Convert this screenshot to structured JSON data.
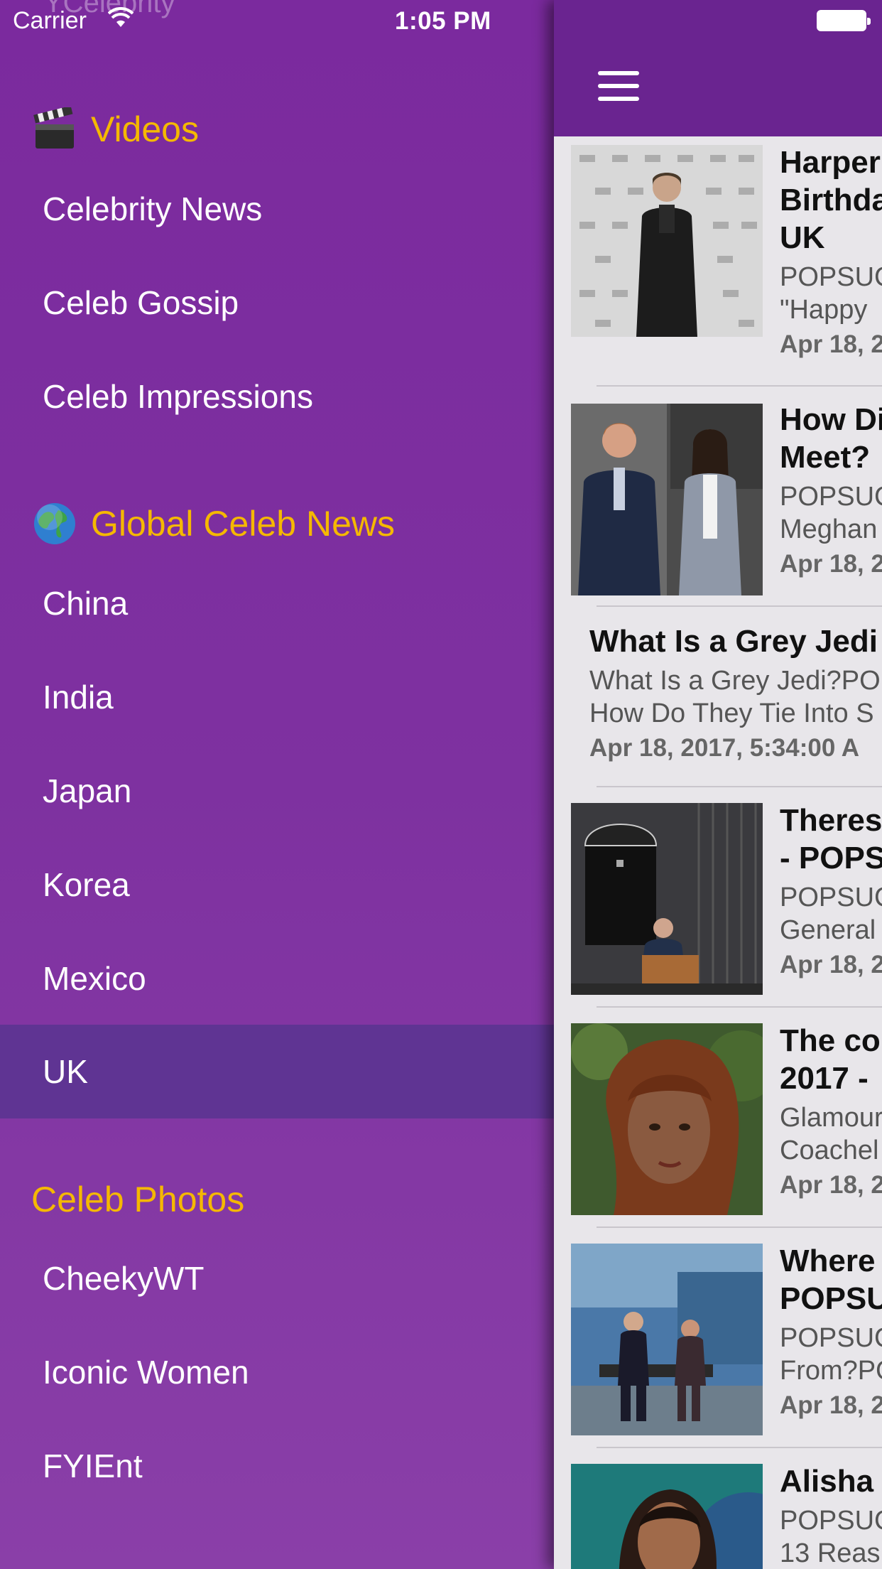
{
  "status_bar": {
    "carrier": "Carrier",
    "time": "1:05 PM"
  },
  "drawer": {
    "ghost_title": "YCelebrity",
    "sections": [
      {
        "header": "Videos",
        "icon": "clapperboard-icon",
        "items": [
          "Celebrity News",
          "Celeb Gossip",
          "Celeb Impressions"
        ]
      },
      {
        "header": "Global Celeb News",
        "icon": "globe-icon",
        "items": [
          "China",
          "India",
          "Japan",
          "Korea",
          "Mexico",
          "UK"
        ]
      },
      {
        "header": "Celeb Photos",
        "icon": "",
        "items": [
          "CheekyWT",
          "Iconic Women",
          "FYIEnt"
        ]
      }
    ],
    "selected_item": "UK"
  },
  "feed": {
    "cards": [
      {
        "title_lines": [
          "Harper",
          "Birthda",
          "UK"
        ],
        "desc_lines": [
          "POPSUC",
          "\"Happy"
        ],
        "date": "Apr 18, 2",
        "has_image": true
      },
      {
        "title_lines": [
          "How Di",
          "Meet?"
        ],
        "desc_lines": [
          "POPSUC",
          "Meghan"
        ],
        "date": "Apr 18, 2",
        "has_image": true
      },
      {
        "title_lines": [
          "What Is a Grey Jedi"
        ],
        "desc_lines": [
          "What Is a Grey Jedi?PO",
          "How Do They Tie Into S"
        ],
        "date": "Apr 18, 2017, 5:34:00 A",
        "has_image": false
      },
      {
        "title_lines": [
          "Theres",
          "- POPS"
        ],
        "desc_lines": [
          "POPSUC",
          "General"
        ],
        "date": "Apr 18, 2",
        "has_image": true
      },
      {
        "title_lines": [
          "The co",
          "2017 -"
        ],
        "desc_lines": [
          "Glamour",
          "Coachel"
        ],
        "date": "Apr 18, 2",
        "has_image": true
      },
      {
        "title_lines": [
          "Where",
          "POPSU"
        ],
        "desc_lines": [
          "POPSUC",
          "From?PO"
        ],
        "date": "Apr 18, 2",
        "has_image": true
      },
      {
        "title_lines": [
          "Alisha"
        ],
        "desc_lines": [
          "POPSUC",
          "13 Reas"
        ],
        "date": "",
        "has_image": true
      }
    ]
  },
  "colors": {
    "drawer_bg": "#7b2a9e",
    "selected_bg": "#5f3493",
    "section_header": "#f5b800",
    "navbar": "#6a2490"
  }
}
